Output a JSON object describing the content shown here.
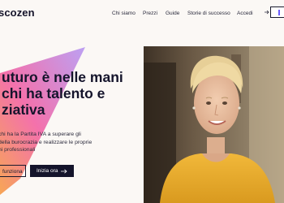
{
  "brand": {
    "logo_text": "scozen"
  },
  "nav": {
    "items": [
      {
        "label": "Chi siamo"
      },
      {
        "label": "Prezzi"
      },
      {
        "label": "Guide"
      },
      {
        "label": "Storie di successo"
      },
      {
        "label": "Accedi"
      }
    ]
  },
  "hero": {
    "headline_lines": [
      "uturo è nelle mani",
      "chi ha talento e",
      "ziativa"
    ],
    "sub_lines": [
      "chi ha la Partita IVA a superare gli",
      "della burocrazia e realizzare le proprie",
      "ni professionali"
    ],
    "secondary_cta": "funziona",
    "primary_cta": "Inizia ora"
  },
  "colors": {
    "background": "#fbf8f5",
    "text": "#14142b",
    "accent": "#6a5cff",
    "gradient": [
      "#f7a14e",
      "#f36aa8",
      "#b99cf3"
    ]
  }
}
